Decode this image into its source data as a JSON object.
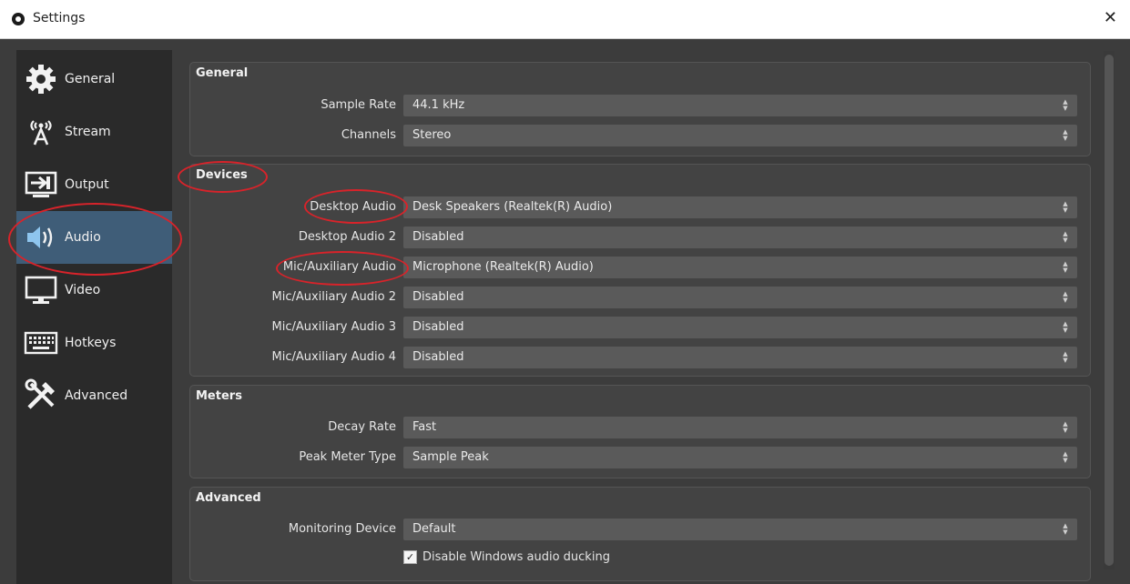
{
  "window": {
    "title": "Settings",
    "close_glyph": "✕"
  },
  "sidebar": {
    "items": [
      {
        "label": "General",
        "icon": "gear-icon"
      },
      {
        "label": "Stream",
        "icon": "antenna-icon"
      },
      {
        "label": "Output",
        "icon": "output-icon"
      },
      {
        "label": "Audio",
        "icon": "speaker-icon",
        "active": true
      },
      {
        "label": "Video",
        "icon": "monitor-icon"
      },
      {
        "label": "Hotkeys",
        "icon": "keyboard-icon"
      },
      {
        "label": "Advanced",
        "icon": "tools-icon"
      }
    ]
  },
  "general": {
    "title": "General",
    "sample_rate": {
      "label": "Sample Rate",
      "value": "44.1 kHz"
    },
    "channels": {
      "label": "Channels",
      "value": "Stereo"
    }
  },
  "devices": {
    "title": "Devices",
    "desktop_audio": {
      "label": "Desktop Audio",
      "value": "Desk Speakers (Realtek(R) Audio)"
    },
    "desktop_audio_2": {
      "label": "Desktop Audio 2",
      "value": "Disabled"
    },
    "mic_audio": {
      "label": "Mic/Auxiliary Audio",
      "value": "Microphone (Realtek(R) Audio)"
    },
    "mic_audio_2": {
      "label": "Mic/Auxiliary Audio 2",
      "value": "Disabled"
    },
    "mic_audio_3": {
      "label": "Mic/Auxiliary Audio 3",
      "value": "Disabled"
    },
    "mic_audio_4": {
      "label": "Mic/Auxiliary Audio 4",
      "value": "Disabled"
    }
  },
  "meters": {
    "title": "Meters",
    "decay_rate": {
      "label": "Decay Rate",
      "value": "Fast"
    },
    "peak_meter_type": {
      "label": "Peak Meter Type",
      "value": "Sample Peak"
    }
  },
  "advanced": {
    "title": "Advanced",
    "monitoring_device": {
      "label": "Monitoring Device",
      "value": "Default"
    },
    "ducking": {
      "label": "Disable Windows audio ducking",
      "checked": true
    }
  },
  "colors": {
    "accent_active": "#3f5d78",
    "annotation_red": "#d8232a",
    "sidebar_bg": "#2a2a2a",
    "panel_bg": "#434343",
    "combo_bg": "#5a5a5a"
  }
}
